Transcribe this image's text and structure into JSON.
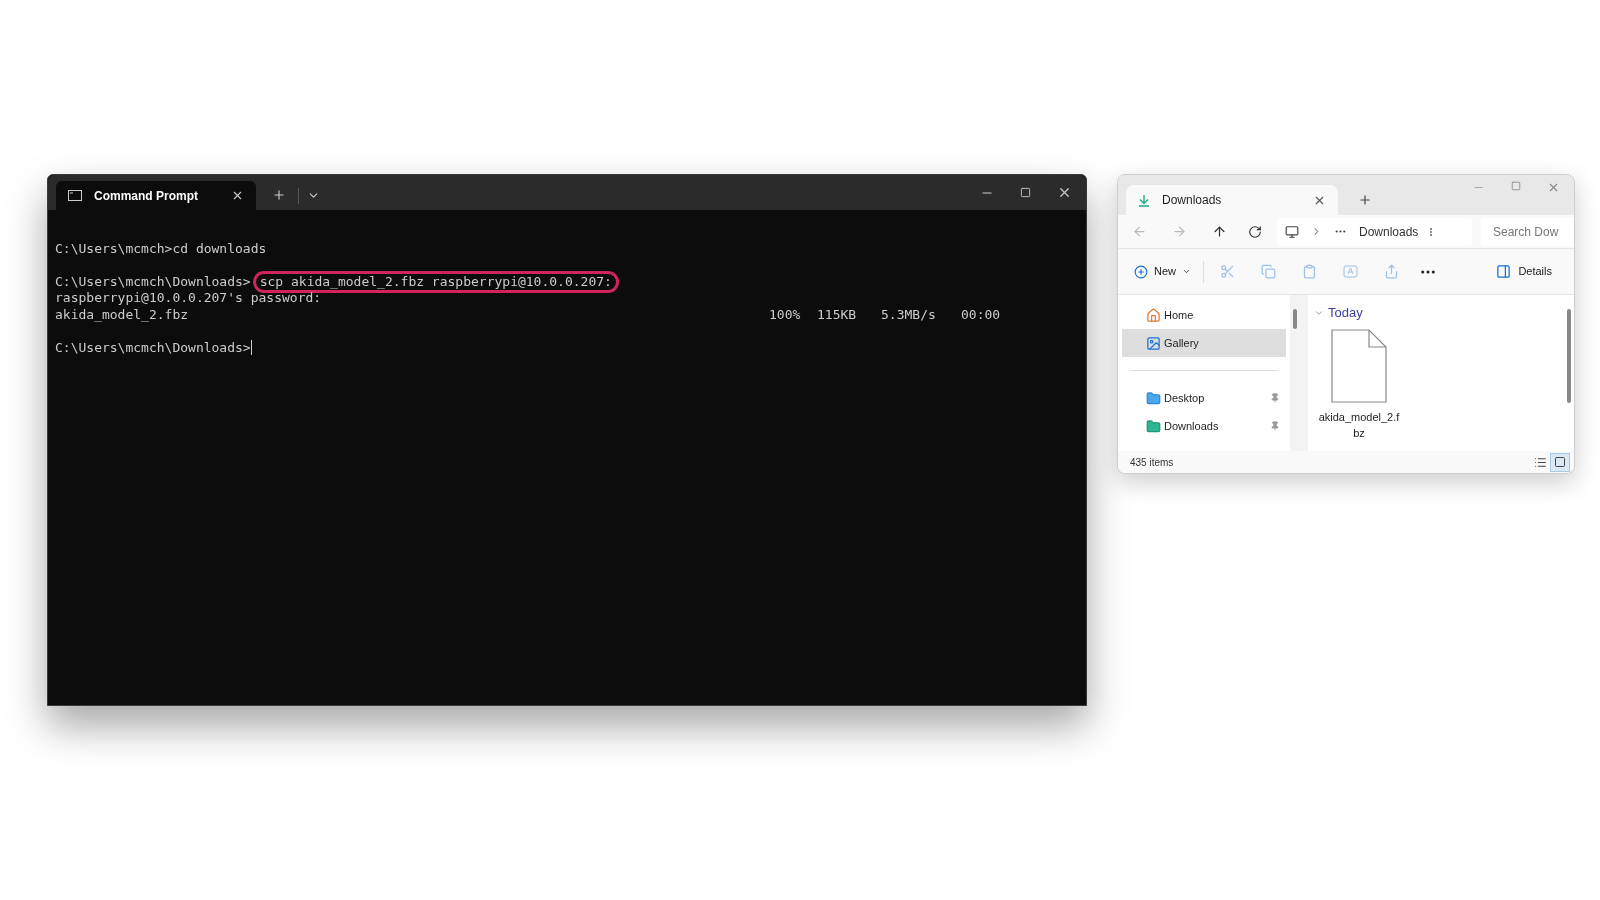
{
  "terminal": {
    "tab_title": "Command Prompt",
    "lines": [
      {
        "kind": "blank"
      },
      {
        "kind": "text",
        "text": "C:\\Users\\mcmch>cd downloads"
      },
      {
        "kind": "blank"
      },
      {
        "kind": "command",
        "prompt": "C:\\Users\\mcmch\\Downloads>",
        "command": "scp akida_model_2.fbz raspberrypi@10.0.0.207:",
        "highlighted": true
      },
      {
        "kind": "text",
        "text": "raspberrypi@10.0.0.207's password:"
      },
      {
        "kind": "progress",
        "file": "akida_model_2.fbz",
        "percent": "100%",
        "size": "115KB",
        "speed": "5.3MB/s",
        "time": "00:00"
      },
      {
        "kind": "blank"
      },
      {
        "kind": "prompt",
        "text": "C:\\Users\\mcmch\\Downloads>",
        "cursor": true
      }
    ]
  },
  "explorer": {
    "tab_title": "Downloads",
    "breadcrumb": "Downloads",
    "search": {
      "placeholder": "Search Dow"
    },
    "new_label": "New",
    "details_label": "Details",
    "sidebar": [
      {
        "kind": "item",
        "label": "Home",
        "selected": false,
        "pinned": false
      },
      {
        "kind": "item",
        "label": "Gallery",
        "selected": true,
        "pinned": false
      },
      {
        "kind": "divider"
      },
      {
        "kind": "item",
        "label": "Desktop",
        "selected": false,
        "pinned": true
      },
      {
        "kind": "item",
        "label": "Downloads",
        "selected": false,
        "pinned": true
      }
    ],
    "group": {
      "label": "Today",
      "expanded": true
    },
    "files": [
      {
        "name": "akida_model_2.fbz"
      }
    ],
    "status": "435 items",
    "views": [
      {
        "kind": "details",
        "selected": false
      },
      {
        "kind": "tiles",
        "selected": true
      }
    ]
  }
}
